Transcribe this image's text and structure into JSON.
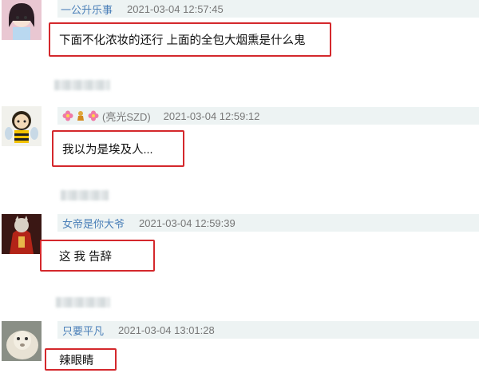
{
  "comments": [
    {
      "username": "一公升乐事",
      "timestamp": "2021-03-04 12:57:45",
      "text": "下面不化浓妆的还行 上面的全包大烟熏是什么鬼"
    },
    {
      "username": "(亮光SZD)",
      "badges": [
        "flower-icon",
        "doll-icon",
        "flower-icon"
      ],
      "timestamp": "2021-03-04 12:59:12",
      "text": "我以为是埃及人..."
    },
    {
      "username": "女帝是你大爷",
      "timestamp": "2021-03-04 12:59:39",
      "text": "这 我 告辞"
    },
    {
      "username": "只要平凡",
      "timestamp": "2021-03-04 13:01:28",
      "text": "辣眼睛"
    }
  ],
  "colors": {
    "highlight": "#d4282c",
    "meta_bar_bg": "#edf3f3",
    "username": "#4a7fb8"
  }
}
